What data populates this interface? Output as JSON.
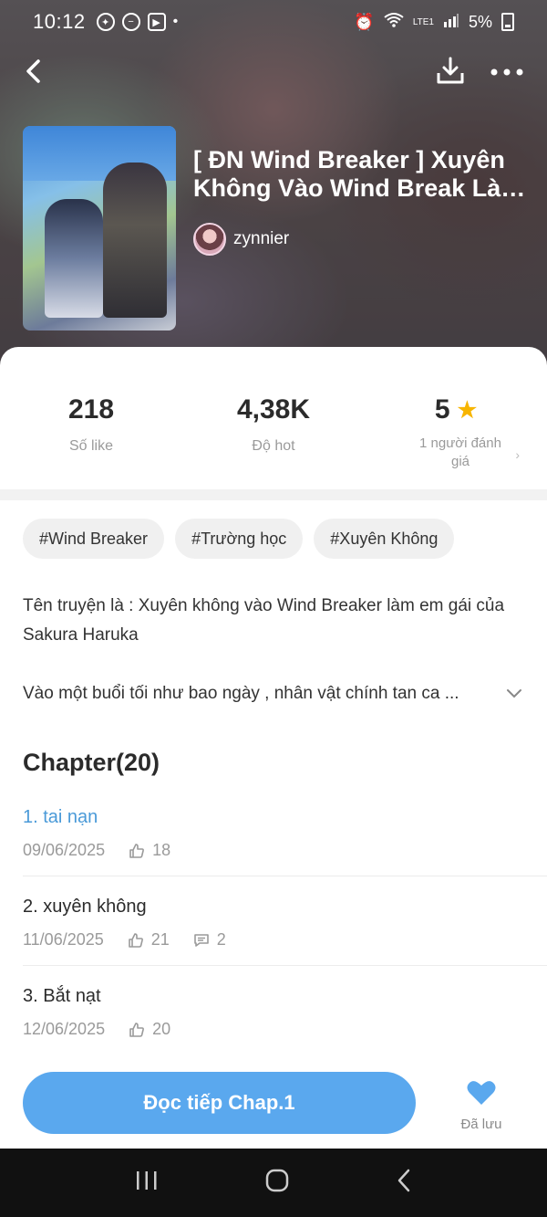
{
  "status_bar": {
    "time": "10:12",
    "battery": "5%",
    "network": "LTE1"
  },
  "book": {
    "title_line1": "[ ĐN Wind Breaker ] Xuyên",
    "title_line2": "Không Vào Wind Break Làm...",
    "author": "zynnier"
  },
  "stats": {
    "likes_value": "218",
    "likes_label": "Số like",
    "hot_value": "4,38K",
    "hot_label": "Độ hot",
    "rating_value": "5",
    "rating_label": "1 người đánh giá"
  },
  "tags": [
    "#Wind Breaker",
    "#Trường học",
    "#Xuyên Không"
  ],
  "description": {
    "line1": "Tên truyện là : Xuyên không vào Wind Breaker làm em gái của Sakura Haruka",
    "line2": "Vào một buổi tối như bao ngày , nhân vật chính tan ca ..."
  },
  "chapters_title": "Chapter(20)",
  "chapters": [
    {
      "title": "1. tai nạn",
      "date": "09/06/2025",
      "likes": "18",
      "comments": ""
    },
    {
      "title": "2. xuyên không",
      "date": "11/06/2025",
      "likes": "21",
      "comments": "2"
    },
    {
      "title": "3. Bắt nạt",
      "date": "12/06/2025",
      "likes": "20",
      "comments": ""
    }
  ],
  "actions": {
    "read_button": "Đọc tiếp Chap.1",
    "saved_label": "Đã lưu"
  },
  "colors": {
    "accent": "#5aa8ee",
    "active_chapter": "#4a9ad8",
    "star": "#f7b500"
  }
}
